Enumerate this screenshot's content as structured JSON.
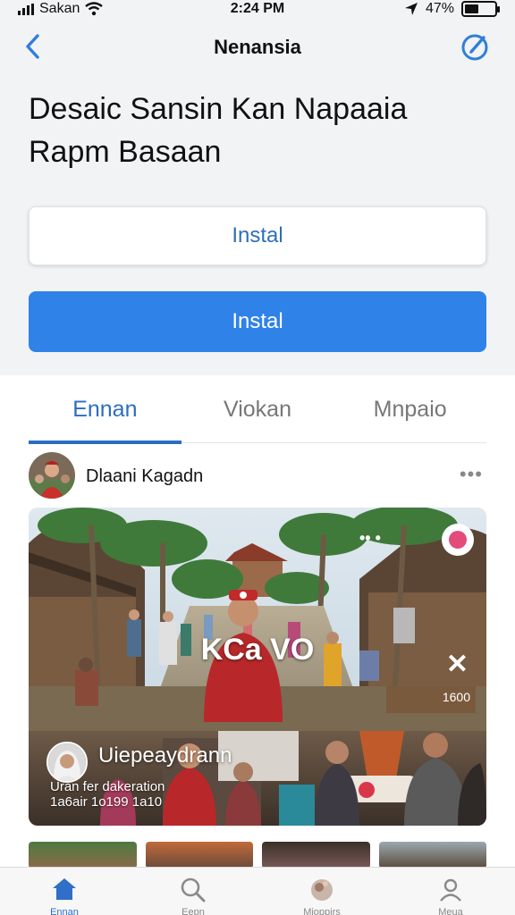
{
  "status_bar": {
    "carrier": "Sakan",
    "time": "2:24 PM",
    "battery": "47%",
    "battery_level": 0.47
  },
  "nav": {
    "title": "Nenansia"
  },
  "heading": {
    "line1": "Desaic Sansin Kan Napaaia",
    "line2": "Rapm Basaan"
  },
  "buttons": {
    "secondary_label": "Instal",
    "primary_label": "Instal"
  },
  "tabs": [
    {
      "label": "Ennan",
      "active": true
    },
    {
      "label": "Viokan",
      "active": false
    },
    {
      "label": "Mnpaio",
      "active": false
    }
  ],
  "post": {
    "author": "Dlaani Kagadn",
    "more": "•••",
    "media": {
      "overlay_title": "KCa VO",
      "dots": "•• •",
      "close": "✕",
      "counter": "1600",
      "sub_title": "Uiepeaydrann",
      "sub_caption": "Uran fer dakeration",
      "sub_caption2": "1a6air 1o199 1a10"
    }
  },
  "tab_bar": [
    {
      "label": "Ennan",
      "icon": "home-icon",
      "active": true
    },
    {
      "label": "Eepn",
      "icon": "search-icon",
      "active": false
    },
    {
      "label": "Mioppirs",
      "icon": "orb-icon",
      "active": false
    },
    {
      "label": "Meua",
      "icon": "profile-icon",
      "active": false
    }
  ],
  "colors": {
    "accent": "#2f82e8",
    "tab_active": "#2a6ebf",
    "header_bg": "#f2f3f5"
  }
}
